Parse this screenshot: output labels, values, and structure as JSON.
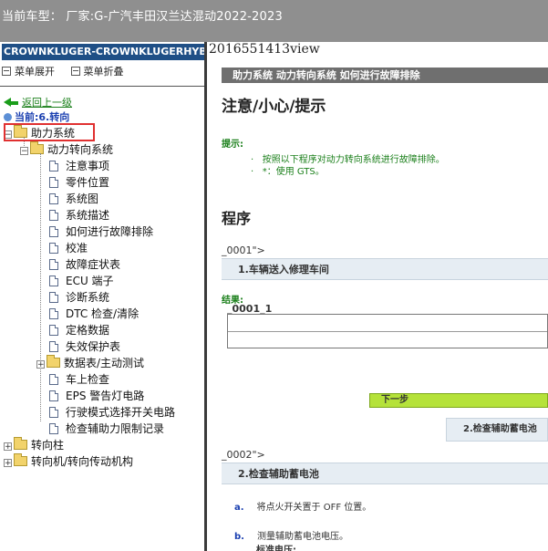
{
  "window": {
    "title": "当前车型： 厂家:G-广汽丰田汉兰达混动2022-2023"
  },
  "sidebar": {
    "vehicle": "CROWNKLUGER-CROWNKLUGERHYBRID",
    "expand_all": "菜单展开",
    "collapse_all": "菜单折叠",
    "back_link": "返回上一级",
    "current": "当前:6.转向",
    "tree": {
      "root": "助力系统",
      "child": "动力转向系统",
      "leaves": [
        "注意事项",
        "零件位置",
        "系统图",
        "系统描述",
        "如何进行故障排除",
        "校准",
        "故障症状表",
        "ECU 端子",
        "诊断系统",
        "DTC 检查/清除",
        "定格数据",
        "失效保护表"
      ],
      "folder2": "数据表/主动测试",
      "leaves2": [
        "车上检查",
        "EPS 警告灯电路",
        "行驶模式选择开关电路",
        "检查辅助力限制记录"
      ],
      "siblings": [
        "转向柱",
        "转向机/转向传动机构"
      ]
    }
  },
  "main": {
    "view_label": "2016551413view",
    "breadcrumb": "助力系统  动力转向系统  如何进行故障排除",
    "heading_caution": "注意/小心/提示",
    "hint_label": "提示:",
    "hint_lines": [
      "按照以下程序对动力转向系统进行故障排除。",
      "*：使用 GTS。"
    ],
    "bullets": [
      "·",
      "·"
    ],
    "heading_procedure": "程序",
    "step1_code": "_0001\">",
    "step1_title": "1.车辆送入修理车间",
    "result_label": "结果:",
    "result_title": "_0001_1",
    "next_button": "下一步",
    "goto_step": "2.检查辅助蓄电池",
    "step2_code": "_0002\">",
    "step2_title": "2.检查辅助蓄电池",
    "sub_a_letter": "a.",
    "sub_a_text": "将点火开关置于 OFF 位置。",
    "sub_b_letter": "b.",
    "sub_b_text": "测量辅助蓄电池电压。",
    "standard_voltage": "标准电压:"
  }
}
